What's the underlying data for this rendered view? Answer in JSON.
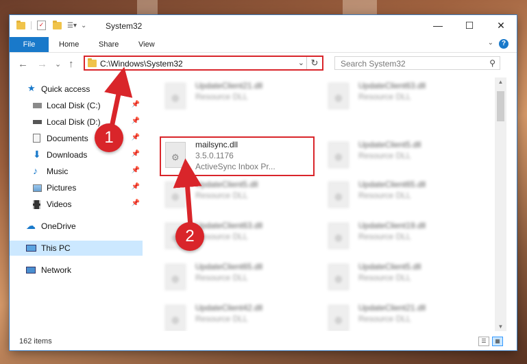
{
  "titlebar": {
    "title": "System32",
    "minimize": "—",
    "maximize": "☐",
    "close": "✕"
  },
  "ribbon": {
    "tabs": [
      "File",
      "Home",
      "Share",
      "View"
    ],
    "help": "?"
  },
  "navbar": {
    "back": "←",
    "forward": "→",
    "recent": "⌄",
    "up": "↑",
    "address": "C:\\Windows\\System32",
    "refresh": "↻",
    "search_placeholder": "Search System32"
  },
  "sidebar": {
    "items": [
      {
        "label": "Quick access",
        "pinned": false
      },
      {
        "label": "Local Disk (C:)",
        "pinned": true
      },
      {
        "label": "Local Disk (D:)",
        "pinned": true
      },
      {
        "label": "Documents",
        "pinned": true
      },
      {
        "label": "Downloads",
        "pinned": true
      },
      {
        "label": "Music",
        "pinned": true
      },
      {
        "label": "Pictures",
        "pinned": true
      },
      {
        "label": "Videos",
        "pinned": true
      },
      {
        "label": "OneDrive",
        "pinned": false
      },
      {
        "label": "This PC",
        "pinned": false,
        "selected": true
      },
      {
        "label": "Network",
        "pinned": false
      }
    ]
  },
  "files": [
    {
      "name": "UpdateClient21.dll",
      "desc": "Resource DLL"
    },
    {
      "name": "UpdateClient63.dll",
      "desc": "Resource DLL"
    },
    {
      "name": "mailsync.dll",
      "desc": "3.5.0.1176",
      "desc2": "ActiveSync Inbox Pr...",
      "highlighted": true
    },
    {
      "name": "UpdateClient5.dll",
      "desc": "Resource DLL"
    },
    {
      "name": "UpdateClient5.dll",
      "desc": "Resource DLL"
    },
    {
      "name": "UpdateClient65.dll",
      "desc": "Resource DLL"
    },
    {
      "name": "UpdateClient63.dll",
      "desc": "Resource DLL"
    },
    {
      "name": "UpdateClient19.dll",
      "desc": "Resource DLL"
    },
    {
      "name": "UpdateClient65.dll",
      "desc": "Resource DLL"
    },
    {
      "name": "UpdateClient5.dll",
      "desc": "Resource DLL"
    },
    {
      "name": "UpdateClient42.dll",
      "desc": "Resource DLL"
    },
    {
      "name": "UpdateClient21.dll",
      "desc": "Resource DLL"
    }
  ],
  "status": {
    "item_count": "162 items"
  },
  "annotations": {
    "step1": "1",
    "step2": "2",
    "color": "#d9252a"
  }
}
